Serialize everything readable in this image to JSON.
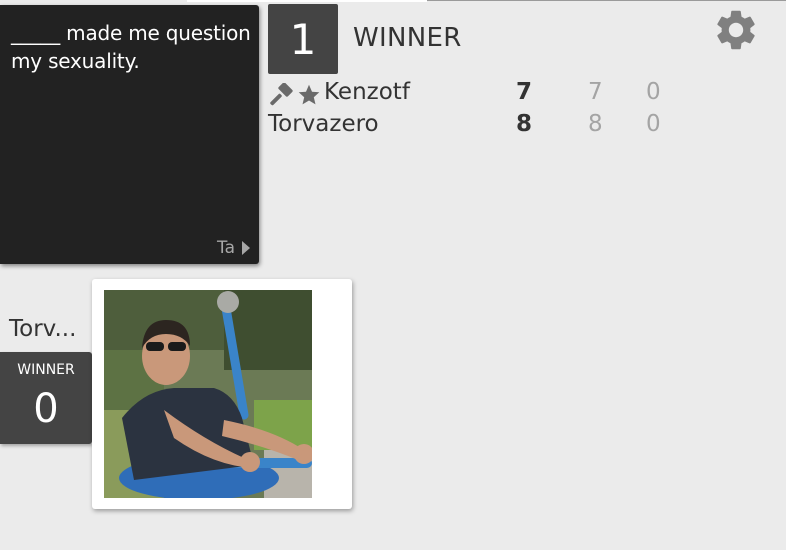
{
  "black_card": {
    "text": "_____ made me question my sexuality.",
    "pack": "Ta"
  },
  "round": {
    "number": "1",
    "status": "WINNER"
  },
  "settings_icon": "gear-icon",
  "scoreboard": [
    {
      "name": "Kenzotf",
      "icons": [
        "gavel-icon",
        "star-icon"
      ],
      "score": "7",
      "stat2": "7",
      "stat3": "0"
    },
    {
      "name": "Torvazero",
      "icons": [],
      "score": "8",
      "stat2": "8",
      "stat3": "0"
    }
  ],
  "played": {
    "player_name": "Torv...",
    "status": "WINNER",
    "points": "0",
    "card_image": "photo of man in sunglasses on blue exercise machine"
  },
  "colors": {
    "background": "#ebebeb",
    "black_card": "#222222",
    "status_box": "#444444",
    "muted_text": "#a4a4a4"
  }
}
